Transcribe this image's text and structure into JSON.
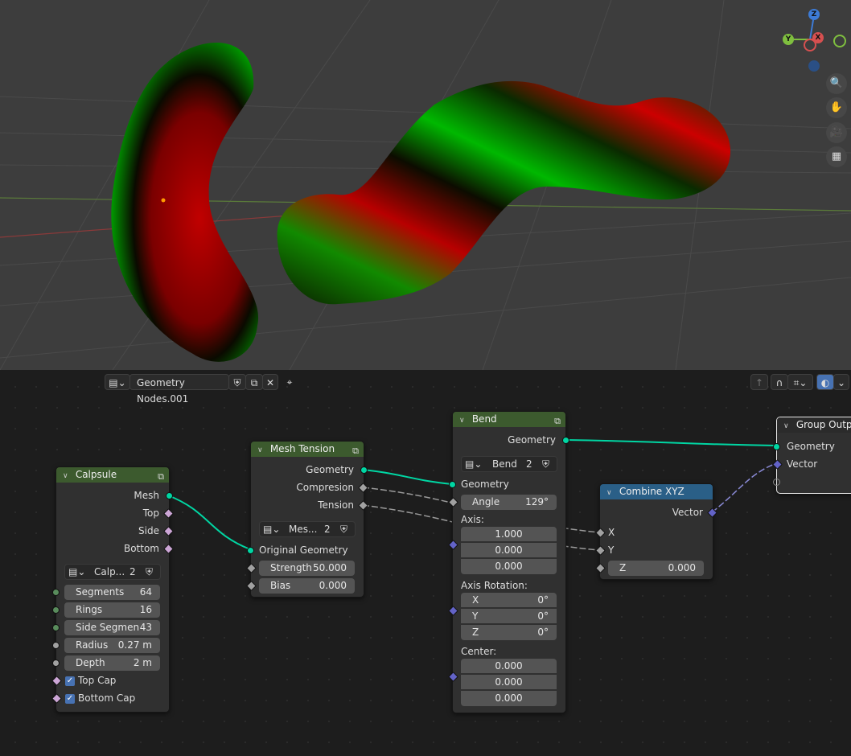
{
  "viewport": {
    "gizmo": {
      "z": "Z",
      "y": "Y",
      "x": "X"
    },
    "tools": [
      "zoom-icon",
      "hand-icon",
      "camera-icon",
      "grid-icon"
    ]
  },
  "header": {
    "datablock_name": "Geometry Nodes.001"
  },
  "nodes": {
    "capsule": {
      "title": "Calpsule",
      "outputs": [
        "Mesh",
        "Top",
        "Side",
        "Bottom"
      ],
      "selector": {
        "name": "Calp...",
        "users": "2"
      },
      "inputs": [
        {
          "label": "Segments",
          "value": "64"
        },
        {
          "label": "Rings",
          "value": "16"
        },
        {
          "label": "Side Segmen",
          "value": "43"
        },
        {
          "label": "Radius",
          "value": "0.27 m"
        },
        {
          "label": "Depth",
          "value": "2 m"
        }
      ],
      "checks": [
        "Top Cap",
        "Bottom Cap"
      ]
    },
    "mesh_tension": {
      "title": "Mesh Tension",
      "outputs": [
        "Geometry",
        "Compresion",
        "Tension"
      ],
      "selector": {
        "name": "Mes...",
        "users": "2"
      },
      "input_label": "Original Geometry",
      "inputs": [
        {
          "label": "Strength",
          "value": "50.000"
        },
        {
          "label": "Bias",
          "value": "0.000"
        }
      ]
    },
    "bend": {
      "title": "Bend",
      "output": "Geometry",
      "selector": {
        "name": "Bend",
        "users": "2"
      },
      "input_geometry": "Geometry",
      "angle": {
        "label": "Angle",
        "value": "129°"
      },
      "axis_label": "Axis:",
      "axis": [
        "1.000",
        "0.000",
        "0.000"
      ],
      "axis_rotation_label": "Axis Rotation:",
      "axis_rotation": [
        {
          "label": "X",
          "value": "0°"
        },
        {
          "label": "Y",
          "value": "0°"
        },
        {
          "label": "Z",
          "value": "0°"
        }
      ],
      "center_label": "Center:",
      "center": [
        "0.000",
        "0.000",
        "0.000"
      ]
    },
    "combine_xyz": {
      "title": "Combine XYZ",
      "output": "Vector",
      "inputs": [
        "X",
        "Y"
      ],
      "z": {
        "label": "Z",
        "value": "0.000"
      }
    },
    "group_output": {
      "title": "Group Output",
      "inputs": [
        "Geometry",
        "Vector"
      ]
    }
  },
  "colors": {
    "geometry_socket": "#00d6a3",
    "vector_socket": "#6363c7",
    "geometry_header": "#3c5a2e",
    "vector_header": "#2a5f87"
  }
}
